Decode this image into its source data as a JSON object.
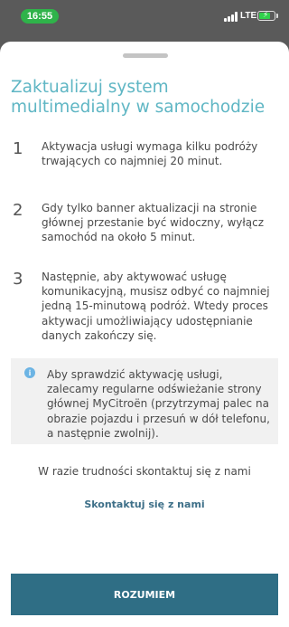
{
  "status_bar": {
    "time": "16:55",
    "network": "LTE",
    "time_pill_color": "#2fb34a",
    "battery_color": "#2fd04a",
    "icons": [
      "signal-icon",
      "battery-charging-icon"
    ]
  },
  "sheet": {
    "title": "Zaktualizuj system multimedialny w samochodzie",
    "title_color": "#5fb6c4",
    "steps": [
      {
        "number": "1",
        "text": "Aktywacja usługi wymaga kilku podróży trwających co najmniej 20 minut."
      },
      {
        "number": "2",
        "text": "Gdy tylko banner aktualizacji na stronie głównej przestanie być widoczny, wyłącz samochód na około 5 minut."
      },
      {
        "number": "3",
        "text": "Następnie, aby aktywować usługę komunikacyjną, musisz odbyć co najmniej jedną 15-minutową podróż. Wtedy proces aktywacji umożliwiający udostępnianie danych zakończy się."
      }
    ],
    "info": {
      "icon": "info-icon",
      "text": "Aby sprawdzić aktywację usługi, zalecamy regularne odświeżanie strony głównej MyCitroën (przytrzymaj palec na obrazie pojazdu i przesuń w dół telefonu, a następnie zwolnij)."
    },
    "contact_prompt": "W razie trudności skontaktuj się z nami",
    "contact_link": "Skontaktuj się z nami",
    "confirm_label": "ROZUMIEM",
    "button_color": "#2f6e85"
  }
}
